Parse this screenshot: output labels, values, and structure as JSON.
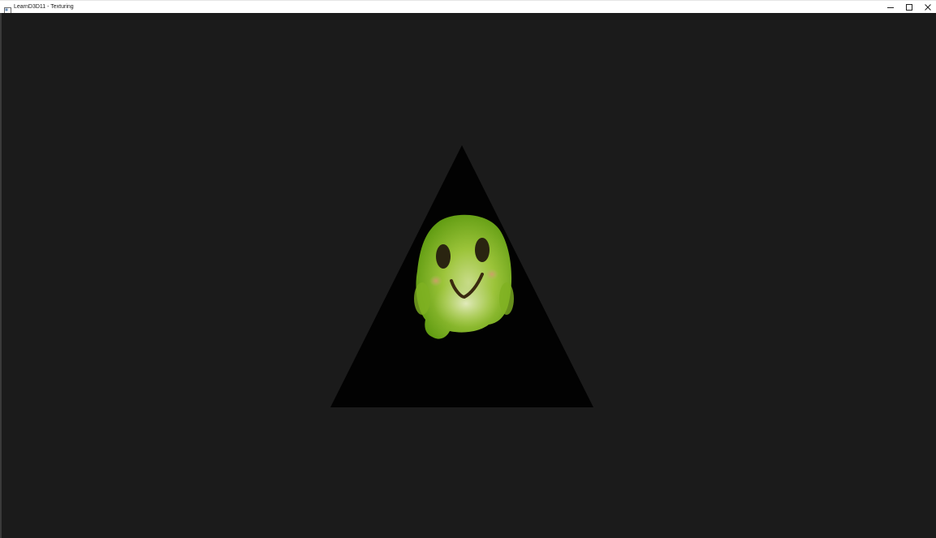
{
  "window": {
    "title": "LearnD3D11 - Texturing",
    "controls": {
      "minimize_icon": "minimize-icon",
      "maximize_icon": "maximize-icon",
      "close_icon": "close-icon"
    }
  },
  "viewport": {
    "clear_color": "#1b1b1b",
    "triangle_color": "#020202",
    "texture_subject": "green-blob-face"
  }
}
